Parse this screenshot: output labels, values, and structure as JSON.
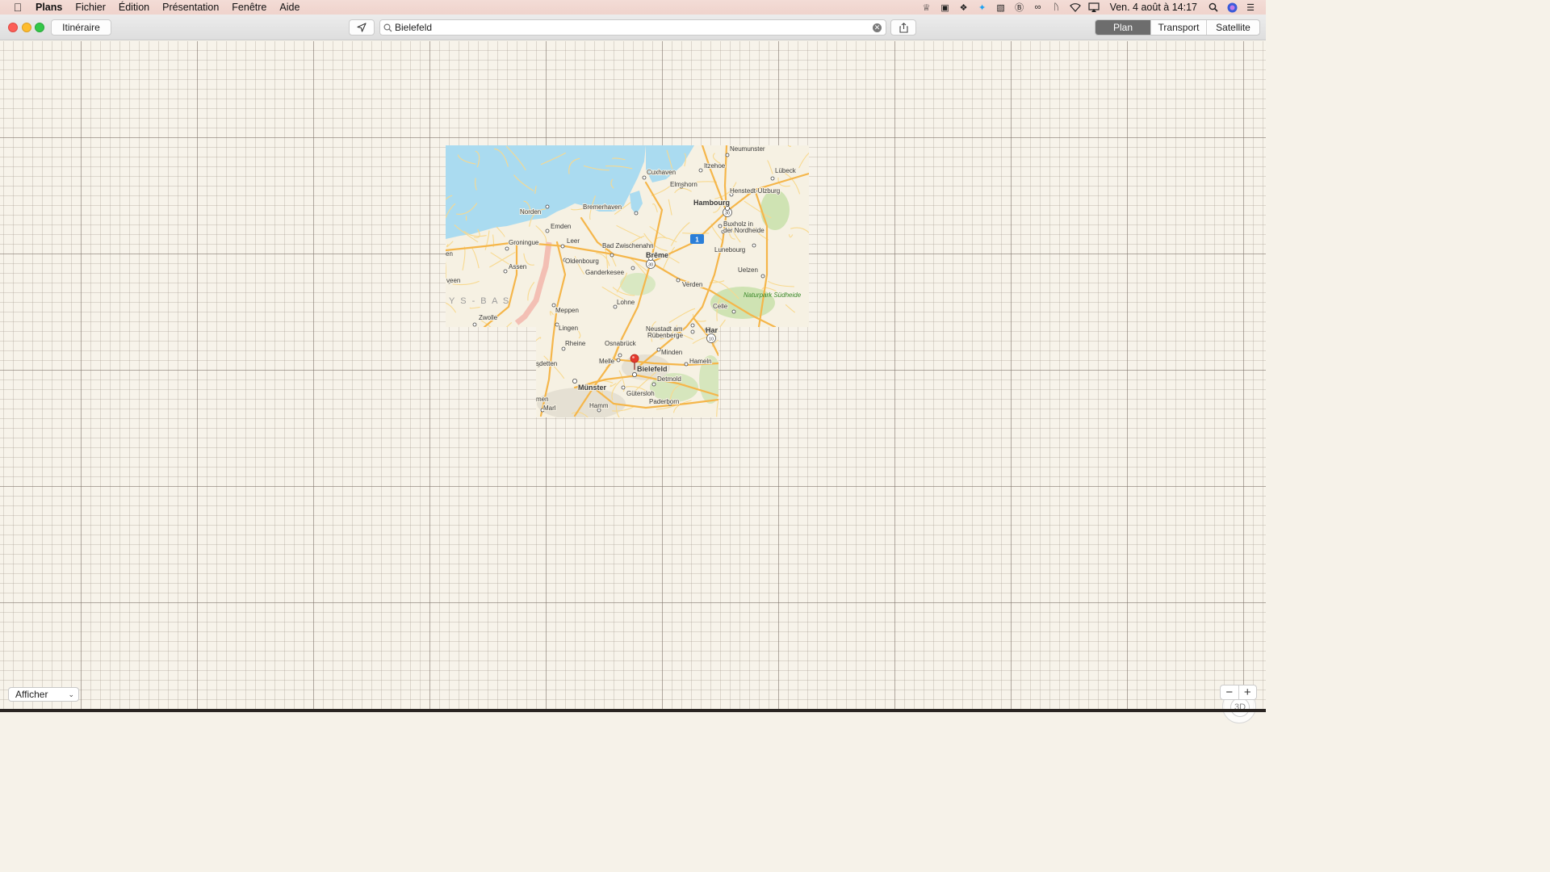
{
  "menubar": {
    "app_name": "Plans",
    "menus": [
      "Fichier",
      "Édition",
      "Présentation",
      "Fenêtre",
      "Aide"
    ],
    "clock": "Ven. 4 août à 14:17",
    "status_icons": [
      "alfred-icon",
      "istat-icon",
      "dropbox-icon",
      "twitter-icon",
      "readkit-icon",
      "b-app-icon",
      "glasses-icon",
      "bluetooth-icon",
      "wifi-icon",
      "airplay-icon"
    ]
  },
  "toolbar": {
    "itinerary_label": "Itinéraire",
    "search_value": "Bielefeld",
    "map_modes": [
      "Plan",
      "Transport",
      "Satellite"
    ],
    "active_mode": "Plan"
  },
  "map": {
    "pin_city": "Bielefeld",
    "region_label": "Y S - B A S",
    "park_label": "Naturpark Südheide",
    "cities": [
      {
        "name": "Neumunster"
      },
      {
        "name": "Itzehoe"
      },
      {
        "name": "Cuxhaven"
      },
      {
        "name": "Lübeck"
      },
      {
        "name": "Elmshorn"
      },
      {
        "name": "Henstedt-Ulzburg"
      },
      {
        "name": "Hambourg"
      },
      {
        "name": "Norden"
      },
      {
        "name": "Bremerhaven"
      },
      {
        "name": "Emden"
      },
      {
        "name": "Buxholz in"
      },
      {
        "name": "der Nordheide"
      },
      {
        "name": "Groningue"
      },
      {
        "name": "Leer"
      },
      {
        "name": "Bad Zwischenahn"
      },
      {
        "name": "Brême"
      },
      {
        "name": "Lunebourg"
      },
      {
        "name": "Oldenbourg"
      },
      {
        "name": "Assen"
      },
      {
        "name": "Ganderkesee"
      },
      {
        "name": "Uelzen"
      },
      {
        "name": "Verden"
      },
      {
        "name": "Lohne"
      },
      {
        "name": "Celle"
      },
      {
        "name": "Meppen"
      },
      {
        "name": "Zwolle"
      },
      {
        "name": "Lingen"
      },
      {
        "name": "Neustadt am"
      },
      {
        "name": "Rübenberge"
      },
      {
        "name": "Har"
      },
      {
        "name": "Rheine"
      },
      {
        "name": "Osnabrück"
      },
      {
        "name": "Minden"
      },
      {
        "name": "Melle"
      },
      {
        "name": "Hameln"
      },
      {
        "name": "Bielefeld"
      },
      {
        "name": "Detmold"
      },
      {
        "name": "Münster"
      },
      {
        "name": "Gütersloh"
      },
      {
        "name": "Paderborn"
      },
      {
        "name": "Hamm"
      },
      {
        "name": "Marl"
      },
      {
        "name": "veen"
      },
      {
        "name": "en"
      },
      {
        "name": "sdetten"
      },
      {
        "name": "men"
      }
    ],
    "road_shields": [
      "1",
      "30",
      "30",
      "10"
    ]
  },
  "controls": {
    "show_label": "Afficher",
    "compass_label": "3D",
    "zoom_out": "−",
    "zoom_in": "+"
  },
  "colors": {
    "water": "#aadbf0",
    "land": "#f6f1e3",
    "road_major": "#f5b64a",
    "road_minor": "#f8d98f",
    "urban": "#e7e2d6",
    "forest": "#cfe3b3",
    "pin": "#e53a2e",
    "active_segment": "#6d6d6d"
  }
}
